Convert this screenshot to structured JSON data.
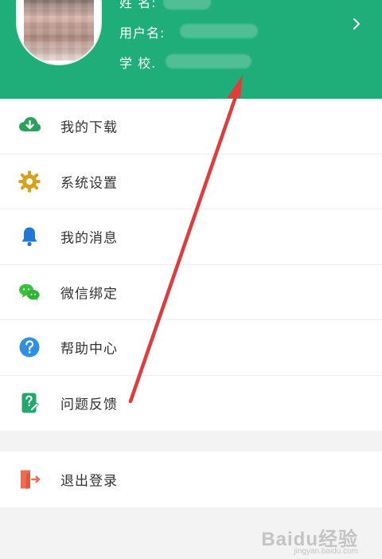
{
  "header": {
    "name_label": "姓  名:",
    "username_label": "用户名:",
    "school_label": "学  校."
  },
  "menu": {
    "items": [
      {
        "label": "我的下载",
        "icon": "download-icon",
        "color": "#2ba15b"
      },
      {
        "label": "系统设置",
        "icon": "gear-icon",
        "color": "#d7a21a"
      },
      {
        "label": "我的消息",
        "icon": "bell-icon",
        "color": "#2377d6"
      },
      {
        "label": "微信绑定",
        "icon": "wechat-icon",
        "color": "#37c13d"
      },
      {
        "label": "帮助中心",
        "icon": "question-icon",
        "color": "#2f8fe0"
      },
      {
        "label": "问题反馈",
        "icon": "feedback-icon",
        "color": "#22a76f"
      }
    ]
  },
  "logout": {
    "label": "退出登录",
    "icon": "logout-icon",
    "color": "#f06c50"
  },
  "watermark": {
    "brand": "Baidu经验",
    "sub": "jingyan.baidu.com"
  },
  "theme": {
    "header_green": "#1fae7a",
    "arrow_red": "#e23b3b"
  }
}
